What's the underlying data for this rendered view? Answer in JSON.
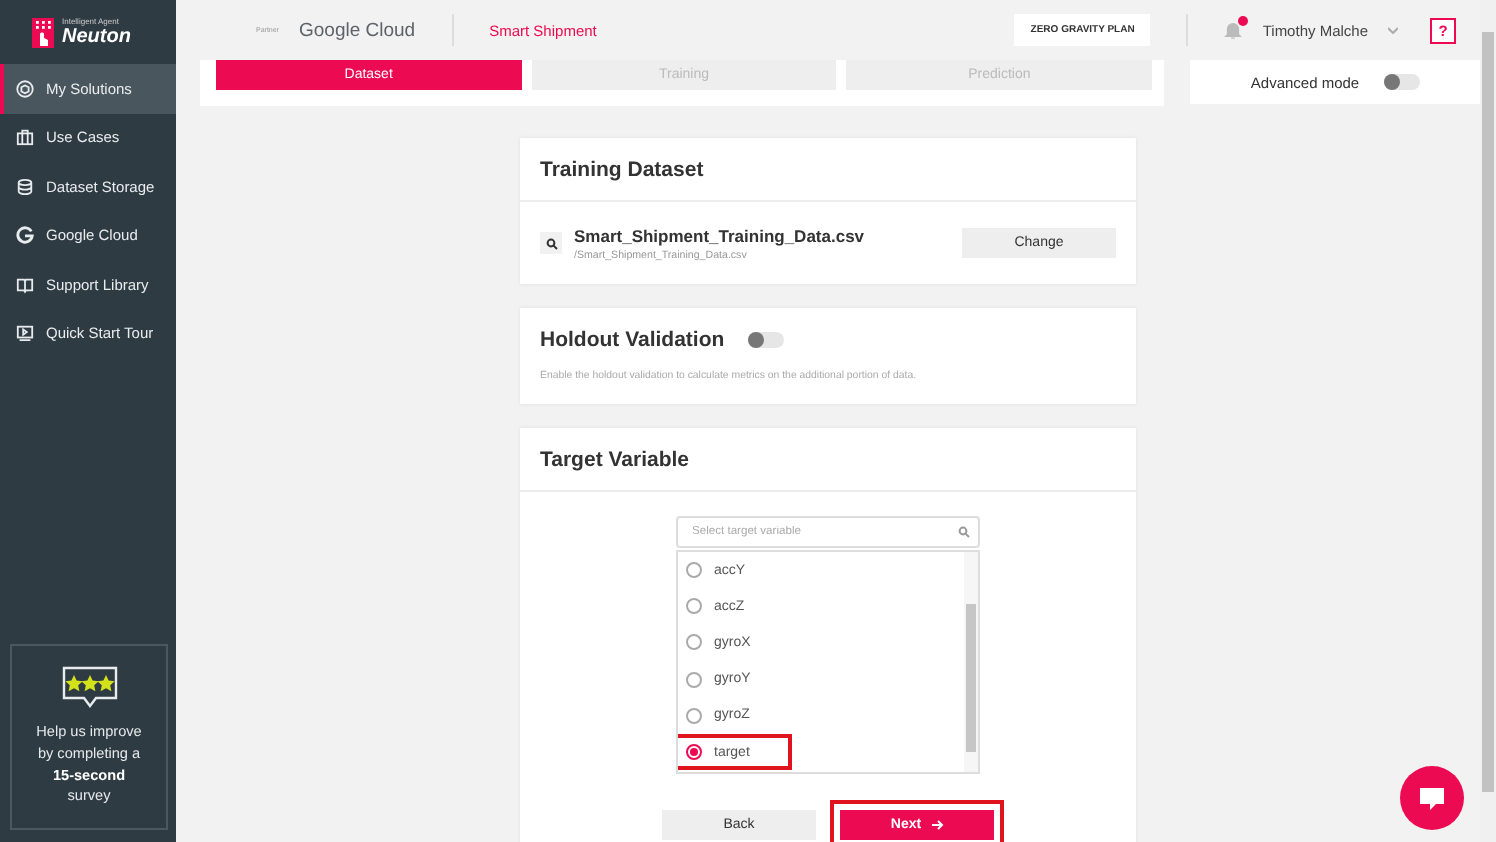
{
  "brand": {
    "tagline": "Intelligent Agent",
    "name": "Neuton"
  },
  "sidebar": {
    "items": [
      {
        "label": "My Solutions",
        "selected": true
      },
      {
        "label": "Use Cases",
        "selected": false
      },
      {
        "label": "Dataset Storage",
        "selected": false
      },
      {
        "label": "Google Cloud",
        "selected": false
      },
      {
        "label": "Support Library",
        "selected": false
      },
      {
        "label": "Quick Start Tour",
        "selected": false
      }
    ],
    "survey": "Help us improve by completing a **15-second** survey"
  },
  "header": {
    "partner": "Partner",
    "partner_name": "Google Cloud",
    "project": "Smart Shipment",
    "plan": "ZERO GRAVITY PLAN",
    "user": "Timothy Malche",
    "help": "?",
    "notifications": true
  },
  "steps": [
    {
      "label": "Dataset",
      "selected": true
    },
    {
      "label": "Training",
      "selected": false
    },
    {
      "label": "Prediction",
      "selected": false
    }
  ],
  "advanced_mode": {
    "label": "Advanced mode",
    "on": false
  },
  "training_dataset": {
    "title": "Training Dataset",
    "file": "Smart_Shipment_Training_Data.csv",
    "path": "/Smart_Shipment_Training_Data.csv",
    "button": "Change"
  },
  "holdout": {
    "title": "Holdout Validation",
    "on": false,
    "description": "Enable the holdout validation to calculate metrics on the additional portion of data."
  },
  "target": {
    "title": "Target Variable",
    "search_placeholder": "Select target variable",
    "options": [
      {
        "label": "accY",
        "selected": false,
        "highlighted": false
      },
      {
        "label": "accZ",
        "selected": false,
        "highlighted": false
      },
      {
        "label": "gyroX",
        "selected": false,
        "highlighted": false
      },
      {
        "label": "gyroY",
        "selected": false,
        "highlighted": false
      },
      {
        "label": "gyroZ",
        "selected": false,
        "highlighted": false
      },
      {
        "label": "target",
        "selected": true,
        "highlighted": true
      }
    ]
  },
  "buttons": [
    {
      "label": "Back",
      "kind": "secondary",
      "highlighted": false
    },
    {
      "label": "Next",
      "kind": "primary",
      "highlighted": true
    }
  ]
}
